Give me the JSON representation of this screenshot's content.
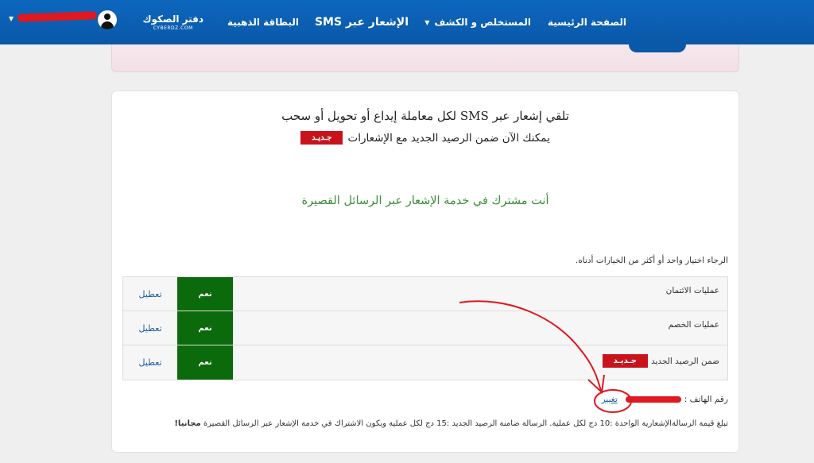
{
  "navbar": {
    "home": "الصفحة الرئيسية",
    "statements": "المستخلص و الكشف",
    "sms": "الإشعار عبر SMS",
    "gold_card": "البطاقة الذهبية",
    "checkbook": "دفتر الصكوك",
    "checkbook_sub": "CYBERDZ.COM",
    "caret": "▼"
  },
  "main": {
    "headline": "تلقي إشعار عبر SMS لكل معاملة إيداع أو تحويل أو سحب",
    "new_badge": "جـديـد",
    "subline": "يمكنك الآن ضمن الرصيد الجديد مع الإشعارات",
    "subscribed": "أنت مشترك في خدمة الإشعار عبر الرسائل القصيرة",
    "choose": "الرجاء اختيار واحد أو أكثر من الخيارات أدناه.",
    "options": [
      {
        "label": "عمليات الائتمان",
        "yes": "نعم",
        "disable": "تعطيل"
      },
      {
        "label": "عمليات الخصم",
        "yes": "نعم",
        "disable": "تعطيل"
      },
      {
        "label": "ضمن الرصيد الجديد",
        "badge": "جـديـد",
        "yes": "نعم",
        "disable": "تعطيل"
      }
    ],
    "phone_label": "رقم الهاتف :",
    "change": "تغيير",
    "price_note": "تبلغ قيمة الرسالةالإشعارية الواحدة :10 دج لكل عملية. الرسالة ضامنة الرصيد الجديد :15 دج لكل عملية ويكون الاشتراك في خدمة الإشعار عبر الرسائل القصيرة",
    "price_free": "مجانيا!"
  },
  "colors": {
    "nav": "#0a58a8",
    "badge": "#c8131c",
    "yes": "#0b6a0b",
    "subscribed": "#3a8c3a",
    "link": "#1a5fa0"
  }
}
